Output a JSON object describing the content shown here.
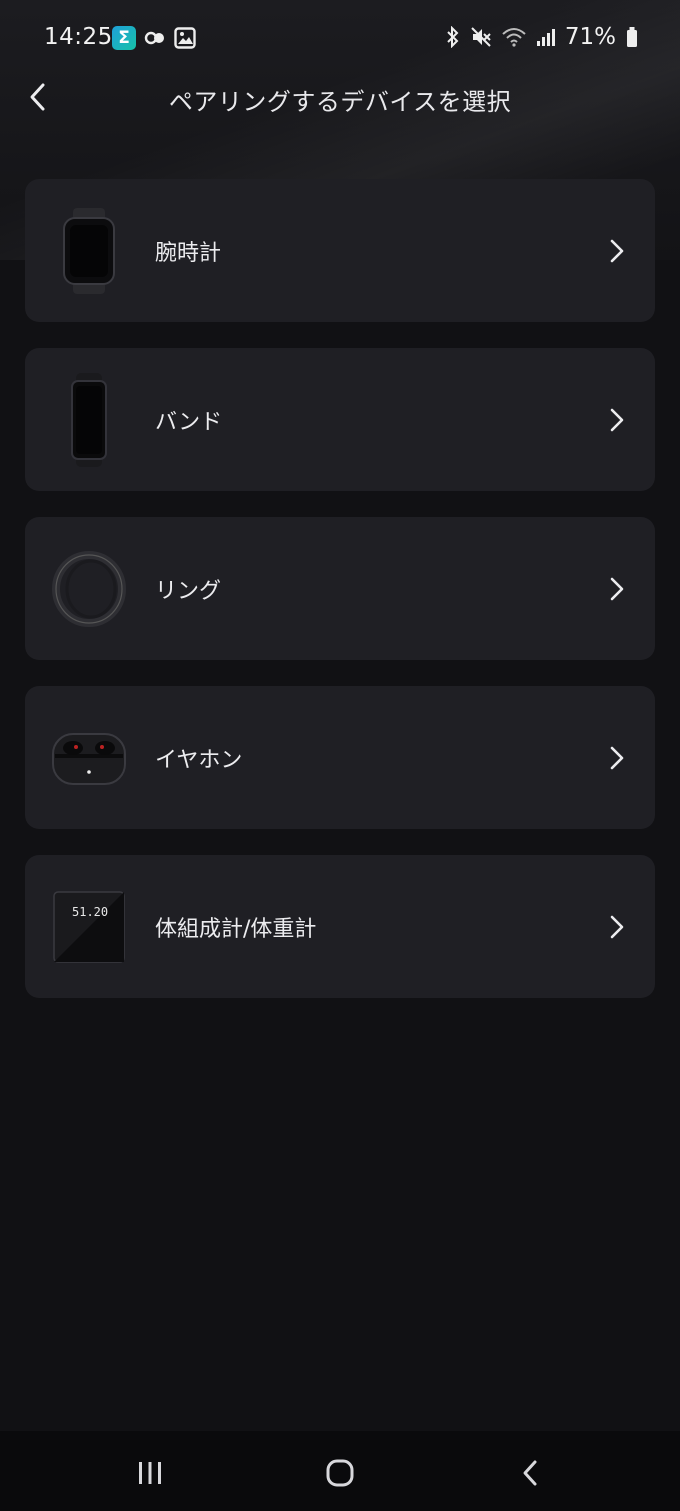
{
  "status_bar": {
    "time": "14:25",
    "battery": "71%",
    "left_icons": [
      "sigma-app-icon",
      "link-icon",
      "gallery-icon"
    ],
    "right_icons": [
      "bluetooth-icon",
      "mute-icon",
      "wifi-icon",
      "signal-icon",
      "battery-icon"
    ]
  },
  "header": {
    "title": "ペアリングするデバイスを選択"
  },
  "devices": [
    {
      "label": "腕時計",
      "icon": "smartwatch-icon"
    },
    {
      "label": "バンド",
      "icon": "fitness-band-icon"
    },
    {
      "label": "リング",
      "icon": "smart-ring-icon"
    },
    {
      "label": "イヤホン",
      "icon": "earbuds-icon"
    },
    {
      "label": "体組成計/体重計",
      "icon": "scale-icon",
      "scale_reading": "51.20"
    }
  ],
  "nav_bar": {
    "buttons": [
      "recents-icon",
      "home-icon",
      "back-icon"
    ]
  },
  "colors": {
    "background": "#111114",
    "card": "#1f1f24",
    "text": "#ececef"
  }
}
